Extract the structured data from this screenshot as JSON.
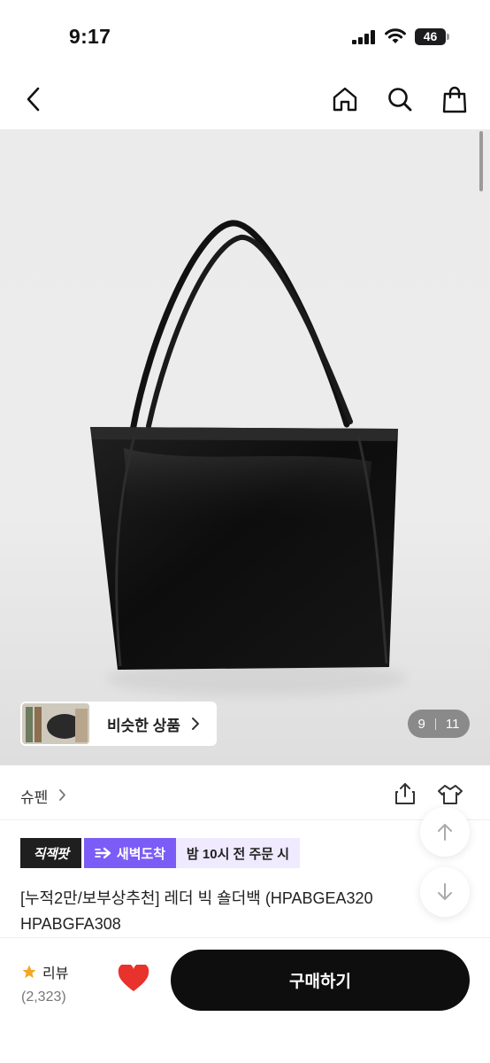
{
  "status_bar": {
    "time": "9:17",
    "battery": "46"
  },
  "nav": {
    "back_icon": "chevron-left-icon",
    "home_icon": "home-icon",
    "search_icon": "search-icon",
    "cart_icon": "shopping-bag-icon"
  },
  "hero": {
    "similar_label": "비슷한 상품",
    "counter_current": "9",
    "counter_total": "11"
  },
  "brand": {
    "name": "슈펜"
  },
  "badges": {
    "zigzag": "직잭팟",
    "dawn": "새벽도착",
    "order": "밤 10시 전 주문 시"
  },
  "product": {
    "title": "[누적2만/보부상추천] 레더 빅 숄더백 (HPABGEA320 HPABGFA308"
  },
  "bottom": {
    "review_label": "리뷰",
    "review_count": "(2,323)",
    "buy_label": "구매하기"
  },
  "colors": {
    "accent_purple": "#7b5cf6",
    "heart_red": "#e8322b",
    "star_orange": "#f5a623",
    "buy_black": "#0e0e0e"
  }
}
